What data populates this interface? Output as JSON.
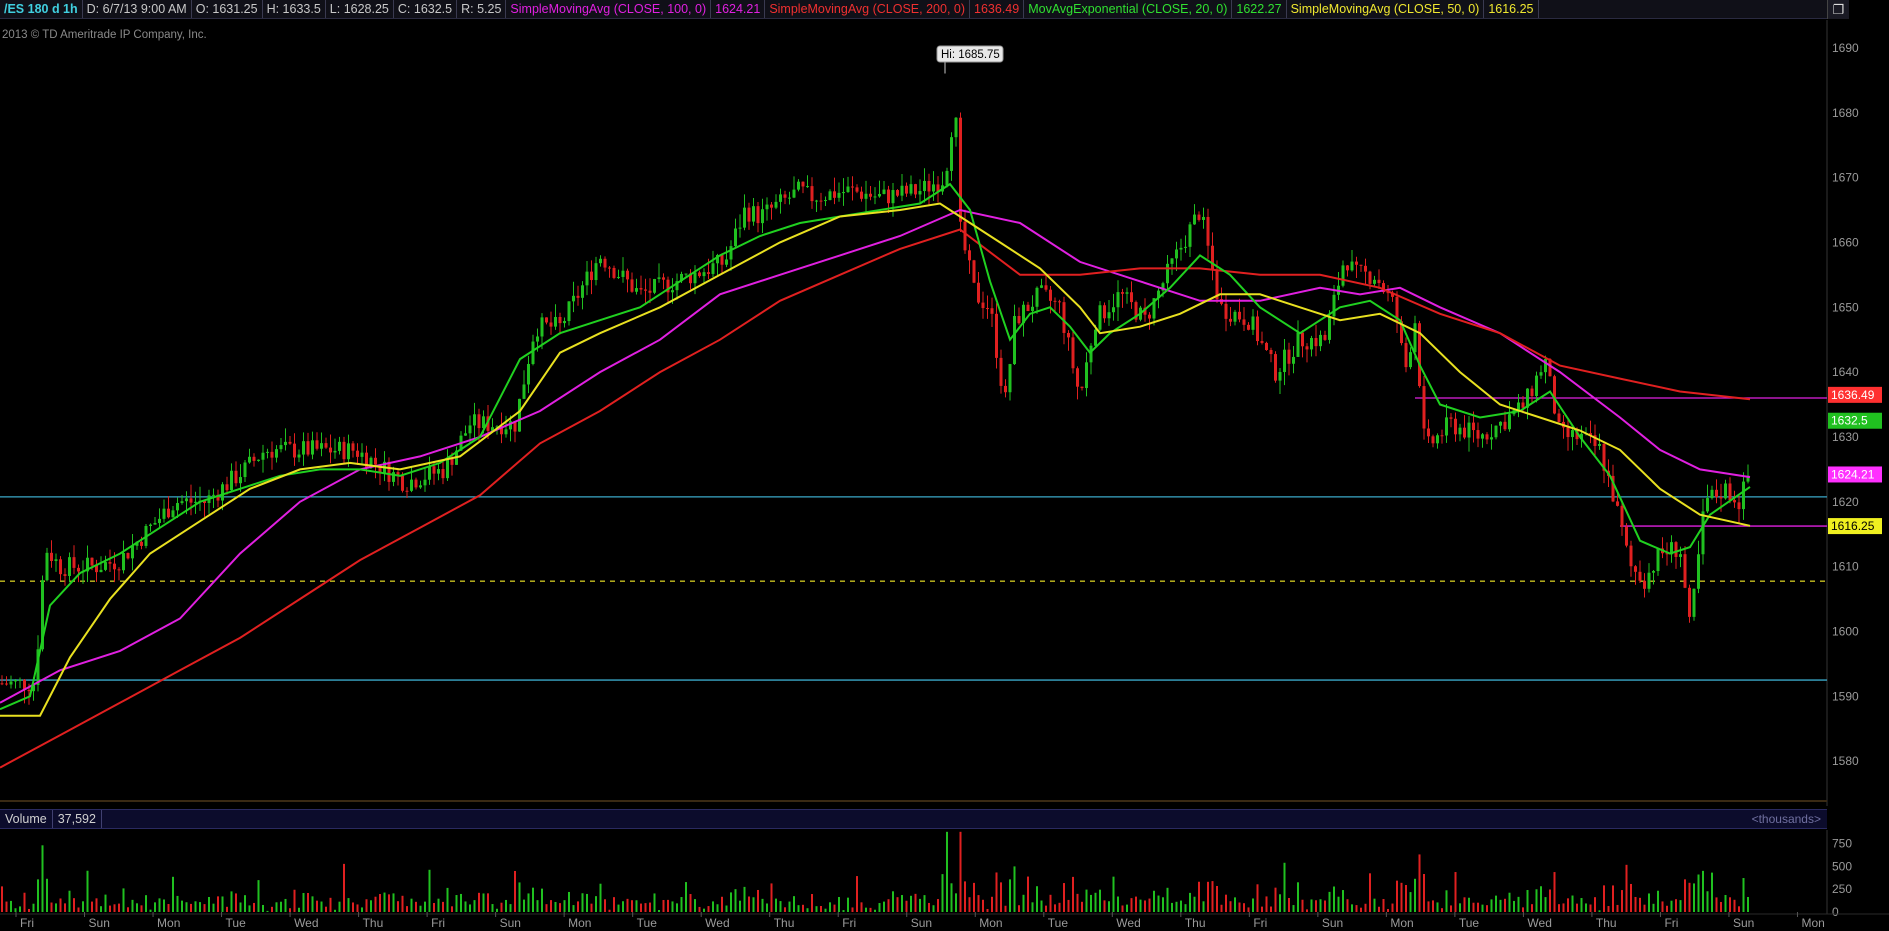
{
  "header": {
    "symbol": "/ES 180 d 1h",
    "date": "D: 6/7/13 9:00 AM",
    "open": "O: 1631.25",
    "high": "H: 1633.5",
    "low": "L: 1628.25",
    "close": "C: 1632.5",
    "range": "R: 5.25",
    "studies": [
      {
        "label": "SimpleMovingAvg (CLOSE, 100, 0)",
        "value": "1624.21",
        "color": "#e020e0"
      },
      {
        "label": "SimpleMovingAvg (CLOSE, 200, 0)",
        "value": "1636.49",
        "color": "#e02020"
      },
      {
        "label": "MovAvgExponential (CLOSE, 20, 0)",
        "value": "1622.27",
        "color": "#20d020"
      },
      {
        "label": "SimpleMovingAvg (CLOSE, 50, 0)",
        "value": "1616.25",
        "color": "#e8e020"
      }
    ],
    "corner_icon": "restore-icon"
  },
  "copyright": "2013 © TD Ameritrade IP Company, Inc.",
  "high_label": "Hi: 1685.75",
  "volume": {
    "label": "Volume",
    "value": "37,592",
    "units": "<thousands>"
  },
  "colors": {
    "up": "#20c020",
    "down": "#e02020",
    "sma100": "#e020e0",
    "sma200": "#e02020",
    "ema20": "#20d020",
    "sma50": "#e8e020",
    "hline_blue": "#3aa8c8",
    "hline_magenta": "#e020e0",
    "hline_yellow_dash": "#c8c020"
  },
  "chart_data": {
    "type": "candlestick",
    "y_axis_ticks": [
      1690,
      1680,
      1670,
      1660,
      1650,
      1640,
      1630,
      1620,
      1610,
      1600,
      1590,
      1580
    ],
    "ylim": [
      1574,
      1694
    ],
    "x_axis_labels": [
      "Fri",
      "Sun",
      "Mon",
      "Tue",
      "Wed",
      "Thu",
      "Fri",
      "Sun",
      "Mon",
      "Tue",
      "Wed",
      "Thu",
      "Fri",
      "Sun",
      "Mon",
      "Tue",
      "Wed",
      "Thu",
      "Fri",
      "Sun",
      "Mon",
      "Tue",
      "Wed",
      "Thu",
      "Fri",
      "Sun",
      "Mon"
    ],
    "price_path": [
      [
        0,
        1592
      ],
      [
        35,
        1592
      ],
      [
        45,
        1613
      ],
      [
        60,
        1610
      ],
      [
        95,
        1610
      ],
      [
        120,
        1611
      ],
      [
        150,
        1616
      ],
      [
        175,
        1620
      ],
      [
        205,
        1620
      ],
      [
        245,
        1625
      ],
      [
        265,
        1628
      ],
      [
        305,
        1628
      ],
      [
        355,
        1628
      ],
      [
        405,
        1623
      ],
      [
        445,
        1625
      ],
      [
        470,
        1632
      ],
      [
        515,
        1632
      ],
      [
        535,
        1647
      ],
      [
        560,
        1647
      ],
      [
        600,
        1658
      ],
      [
        640,
        1652
      ],
      [
        675,
        1654
      ],
      [
        725,
        1657
      ],
      [
        745,
        1665
      ],
      [
        760,
        1664
      ],
      [
        800,
        1668
      ],
      [
        810,
        1667
      ],
      [
        850,
        1668
      ],
      [
        880,
        1667
      ],
      [
        920,
        1668
      ],
      [
        945,
        1670
      ],
      [
        955,
        1682
      ],
      [
        960,
        1662
      ],
      [
        975,
        1652
      ],
      [
        990,
        1650
      ],
      [
        1005,
        1635
      ],
      [
        1015,
        1648
      ],
      [
        1040,
        1652
      ],
      [
        1060,
        1650
      ],
      [
        1080,
        1636
      ],
      [
        1095,
        1648
      ],
      [
        1120,
        1652
      ],
      [
        1145,
        1648
      ],
      [
        1170,
        1656
      ],
      [
        1200,
        1665
      ],
      [
        1220,
        1650
      ],
      [
        1250,
        1648
      ],
      [
        1275,
        1640
      ],
      [
        1300,
        1645
      ],
      [
        1325,
        1645
      ],
      [
        1345,
        1658
      ],
      [
        1355,
        1655
      ],
      [
        1375,
        1655
      ],
      [
        1395,
        1650
      ],
      [
        1405,
        1640
      ],
      [
        1415,
        1648
      ],
      [
        1425,
        1628
      ],
      [
        1450,
        1632
      ],
      [
        1480,
        1630
      ],
      [
        1500,
        1632
      ],
      [
        1525,
        1635
      ],
      [
        1545,
        1642
      ],
      [
        1560,
        1630
      ],
      [
        1580,
        1630
      ],
      [
        1600,
        1628
      ],
      [
        1615,
        1620
      ],
      [
        1630,
        1610
      ],
      [
        1645,
        1608
      ],
      [
        1660,
        1612
      ],
      [
        1680,
        1613
      ],
      [
        1690,
        1600
      ],
      [
        1705,
        1620
      ],
      [
        1725,
        1622
      ],
      [
        1740,
        1620
      ],
      [
        1748,
        1624
      ],
      [
        1752,
        1632
      ]
    ],
    "bar_step_px": 4.5,
    "series": [
      {
        "name": "SimpleMovingAvg (CLOSE, 100, 0)",
        "key": "sma100",
        "points": [
          [
            0,
            1589
          ],
          [
            60,
            1594
          ],
          [
            120,
            1597
          ],
          [
            180,
            1602
          ],
          [
            240,
            1612
          ],
          [
            300,
            1620
          ],
          [
            360,
            1625
          ],
          [
            420,
            1627
          ],
          [
            480,
            1630
          ],
          [
            540,
            1634
          ],
          [
            600,
            1640
          ],
          [
            660,
            1645
          ],
          [
            720,
            1652
          ],
          [
            780,
            1655
          ],
          [
            840,
            1658
          ],
          [
            900,
            1661
          ],
          [
            960,
            1665
          ],
          [
            1020,
            1663
          ],
          [
            1080,
            1657
          ],
          [
            1140,
            1654
          ],
          [
            1200,
            1651
          ],
          [
            1260,
            1651
          ],
          [
            1320,
            1653
          ],
          [
            1360,
            1652
          ],
          [
            1400,
            1653
          ],
          [
            1440,
            1650
          ],
          [
            1500,
            1646
          ],
          [
            1560,
            1640
          ],
          [
            1620,
            1633
          ],
          [
            1660,
            1628
          ],
          [
            1700,
            1625
          ],
          [
            1750,
            1623.8
          ]
        ]
      },
      {
        "name": "SimpleMovingAvg (CLOSE, 200, 0)",
        "key": "sma200",
        "points": [
          [
            0,
            1579
          ],
          [
            60,
            1584
          ],
          [
            120,
            1589
          ],
          [
            180,
            1594
          ],
          [
            240,
            1599
          ],
          [
            300,
            1605
          ],
          [
            360,
            1611
          ],
          [
            420,
            1616
          ],
          [
            480,
            1621
          ],
          [
            540,
            1629
          ],
          [
            600,
            1634
          ],
          [
            660,
            1640
          ],
          [
            720,
            1645
          ],
          [
            780,
            1651
          ],
          [
            840,
            1655
          ],
          [
            900,
            1659
          ],
          [
            960,
            1662
          ],
          [
            1020,
            1655
          ],
          [
            1080,
            1655
          ],
          [
            1140,
            1656
          ],
          [
            1200,
            1656
          ],
          [
            1260,
            1655
          ],
          [
            1320,
            1655
          ],
          [
            1380,
            1653
          ],
          [
            1440,
            1649
          ],
          [
            1500,
            1646
          ],
          [
            1560,
            1641
          ],
          [
            1620,
            1639
          ],
          [
            1680,
            1637
          ],
          [
            1750,
            1635.8
          ]
        ]
      },
      {
        "name": "MovAvgExponential (CLOSE, 20, 0)",
        "key": "ema20",
        "points": [
          [
            0,
            1588
          ],
          [
            30,
            1590
          ],
          [
            50,
            1604
          ],
          [
            80,
            1609
          ],
          [
            120,
            1612
          ],
          [
            160,
            1616
          ],
          [
            200,
            1620
          ],
          [
            240,
            1622
          ],
          [
            280,
            1624
          ],
          [
            320,
            1625
          ],
          [
            360,
            1625
          ],
          [
            400,
            1624
          ],
          [
            440,
            1626
          ],
          [
            480,
            1630
          ],
          [
            520,
            1642
          ],
          [
            560,
            1646
          ],
          [
            600,
            1648
          ],
          [
            640,
            1650
          ],
          [
            680,
            1654
          ],
          [
            720,
            1658
          ],
          [
            760,
            1661
          ],
          [
            800,
            1663
          ],
          [
            840,
            1664
          ],
          [
            880,
            1665
          ],
          [
            920,
            1666
          ],
          [
            950,
            1669
          ],
          [
            970,
            1665
          ],
          [
            990,
            1654
          ],
          [
            1010,
            1645
          ],
          [
            1030,
            1649
          ],
          [
            1050,
            1650
          ],
          [
            1070,
            1647
          ],
          [
            1090,
            1643
          ],
          [
            1110,
            1646
          ],
          [
            1140,
            1649
          ],
          [
            1170,
            1653
          ],
          [
            1200,
            1658
          ],
          [
            1230,
            1655
          ],
          [
            1260,
            1650
          ],
          [
            1300,
            1646
          ],
          [
            1340,
            1650
          ],
          [
            1370,
            1651
          ],
          [
            1400,
            1648
          ],
          [
            1420,
            1641
          ],
          [
            1440,
            1635
          ],
          [
            1480,
            1633
          ],
          [
            1520,
            1634
          ],
          [
            1550,
            1637
          ],
          [
            1580,
            1630
          ],
          [
            1610,
            1624
          ],
          [
            1640,
            1614
          ],
          [
            1670,
            1612
          ],
          [
            1690,
            1613
          ],
          [
            1710,
            1618
          ],
          [
            1750,
            1622.3
          ]
        ]
      },
      {
        "name": "SimpleMovingAvg (CLOSE, 50, 0)",
        "key": "sma50",
        "points": [
          [
            0,
            1587
          ],
          [
            40,
            1587
          ],
          [
            70,
            1596
          ],
          [
            110,
            1605
          ],
          [
            150,
            1612
          ],
          [
            200,
            1617
          ],
          [
            250,
            1622
          ],
          [
            300,
            1625
          ],
          [
            350,
            1626
          ],
          [
            400,
            1625
          ],
          [
            460,
            1627
          ],
          [
            520,
            1634
          ],
          [
            560,
            1643
          ],
          [
            600,
            1646
          ],
          [
            660,
            1650
          ],
          [
            720,
            1655
          ],
          [
            780,
            1660
          ],
          [
            840,
            1664
          ],
          [
            900,
            1665
          ],
          [
            940,
            1666
          ],
          [
            960,
            1664
          ],
          [
            1000,
            1660
          ],
          [
            1040,
            1656
          ],
          [
            1080,
            1650
          ],
          [
            1100,
            1646
          ],
          [
            1140,
            1647
          ],
          [
            1180,
            1649
          ],
          [
            1220,
            1652
          ],
          [
            1260,
            1652
          ],
          [
            1300,
            1650
          ],
          [
            1340,
            1648
          ],
          [
            1380,
            1649
          ],
          [
            1420,
            1646
          ],
          [
            1460,
            1640
          ],
          [
            1500,
            1635
          ],
          [
            1540,
            1633
          ],
          [
            1580,
            1631
          ],
          [
            1620,
            1628
          ],
          [
            1660,
            1622
          ],
          [
            1700,
            1618
          ],
          [
            1750,
            1616.3
          ]
        ]
      }
    ],
    "horizontal_lines": [
      {
        "value": 1620.75,
        "key": "hline_blue",
        "x_start": 0
      },
      {
        "value": 1592.5,
        "key": "hline_blue",
        "x_start": 0
      },
      {
        "value": 1636.0,
        "key": "hline_magenta",
        "x_start": 1415
      },
      {
        "value": 1616.25,
        "key": "hline_magenta",
        "x_start": 1620
      },
      {
        "value": 1607.75,
        "key": "hline_yellow_dash",
        "x_start": 0
      }
    ],
    "price_tags": [
      {
        "value": "1636.49",
        "price": 1636.49,
        "bg": "#ff3030",
        "fg": "#ffffff"
      },
      {
        "value": "1632.5",
        "price": 1632.5,
        "bg": "#20c020",
        "fg": "#ffffff"
      },
      {
        "value": "1624.21",
        "price": 1624.21,
        "bg": "#ff30ff",
        "fg": "#ffffff"
      },
      {
        "value": "1616.25",
        "price": 1616.25,
        "bg": "#f0f020",
        "fg": "#000000"
      }
    ],
    "high_point": {
      "price": 1685.75,
      "x": 945
    },
    "volume_ticks": [
      750,
      500,
      250,
      0
    ]
  }
}
